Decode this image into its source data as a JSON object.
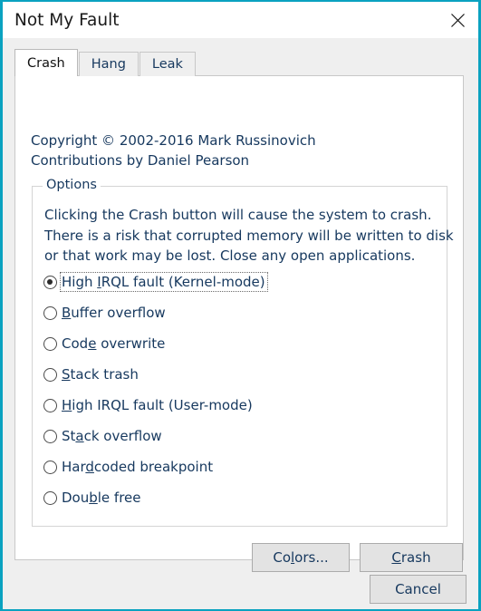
{
  "window": {
    "title": "Not My Fault",
    "close_label": "✕",
    "accent_color": "#0aa2c0",
    "titlebar_bg": "#ffffff",
    "dialog_bg": "#efefef",
    "text_color": "#16385e"
  },
  "tabs": [
    {
      "label": "Crash",
      "active": true
    },
    {
      "label": "Hang",
      "active": false
    },
    {
      "label": "Leak",
      "active": false
    }
  ],
  "crash_tab": {
    "copyright_line1": "Copyright © 2002-2016 Mark Russinovich",
    "copyright_line2": "Contributions by Daniel Pearson",
    "options_group": {
      "legend": "Options",
      "description_line1": "Clicking the Crash button will cause the system to crash.",
      "description_line2": "There is a risk that corrupted memory will be written to disk",
      "description_line3": "or that work may be lost. Close any open applications.",
      "radios": [
        {
          "label": "High IRQL fault (Kernel-mode)",
          "accel_index": 5,
          "checked": true,
          "focused": true
        },
        {
          "label": "Buffer overflow",
          "accel_index": 0,
          "checked": false,
          "focused": false
        },
        {
          "label": "Code overwrite",
          "accel_index": 3,
          "checked": false,
          "focused": false
        },
        {
          "label": "Stack trash",
          "accel_index": 0,
          "checked": false,
          "focused": false
        },
        {
          "label": "High IRQL fault (User-mode)",
          "accel_index": 0,
          "checked": false,
          "focused": false
        },
        {
          "label": "Stack overflow",
          "accel_index": 2,
          "checked": false,
          "focused": false
        },
        {
          "label": "Hardcoded breakpoint",
          "accel_index": 3,
          "checked": false,
          "focused": false
        },
        {
          "label": "Double free",
          "accel_index": 3,
          "checked": false,
          "focused": false
        }
      ]
    },
    "buttons": {
      "colors": {
        "label": "Colors...",
        "accel_index": 2
      },
      "crash": {
        "label": "Crash",
        "accel_index": 0
      }
    }
  },
  "dialog_buttons": {
    "cancel": {
      "label": "Cancel",
      "accel_index": -1
    }
  }
}
